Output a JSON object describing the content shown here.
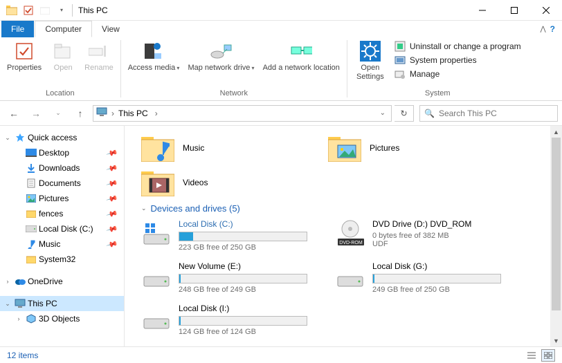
{
  "title": "This PC",
  "tabs": {
    "file": "File",
    "computer": "Computer",
    "view": "View"
  },
  "ribbon": {
    "location": {
      "label": "Location",
      "properties": "Properties",
      "open": "Open",
      "rename": "Rename"
    },
    "network": {
      "label": "Network",
      "access_media": "Access media",
      "map_drive": "Map network drive",
      "add_location": "Add a network location"
    },
    "system": {
      "label": "System",
      "open_settings": "Open Settings",
      "uninstall": "Uninstall or change a program",
      "sys_props": "System properties",
      "manage": "Manage"
    }
  },
  "address": {
    "location": "This PC"
  },
  "search": {
    "placeholder": "Search This PC"
  },
  "sidebar": {
    "quick_access": "Quick access",
    "items": [
      {
        "label": "Desktop",
        "pinned": true
      },
      {
        "label": "Downloads",
        "pinned": true
      },
      {
        "label": "Documents",
        "pinned": true
      },
      {
        "label": "Pictures",
        "pinned": true
      },
      {
        "label": "fences",
        "pinned": true
      },
      {
        "label": "Local Disk (C:)",
        "pinned": true
      },
      {
        "label": "Music",
        "pinned": true
      },
      {
        "label": "System32",
        "pinned": false
      }
    ],
    "onedrive": "OneDrive",
    "this_pc": "This PC",
    "three_d": "3D Objects"
  },
  "folders": {
    "music": "Music",
    "pictures": "Pictures",
    "videos": "Videos"
  },
  "devices_header": "Devices and drives (5)",
  "drives": [
    {
      "name": "Local Disk (C:)",
      "sub": "223 GB free of 250 GB",
      "fill": 11,
      "kind": "os"
    },
    {
      "name": "DVD Drive (D:) DVD_ROM",
      "sub1": "0 bytes free of 382 MB",
      "sub2": "UDF",
      "kind": "dvd"
    },
    {
      "name": "New Volume (E:)",
      "sub": "248 GB free of 249 GB",
      "fill": 1,
      "kind": "hdd"
    },
    {
      "name": "Local Disk (G:)",
      "sub": "249 GB free of 250 GB",
      "fill": 1,
      "kind": "hdd"
    },
    {
      "name": "Local Disk (I:)",
      "sub": "124 GB free of 124 GB",
      "fill": 1,
      "kind": "hdd"
    }
  ],
  "status": {
    "count": "12 items"
  }
}
